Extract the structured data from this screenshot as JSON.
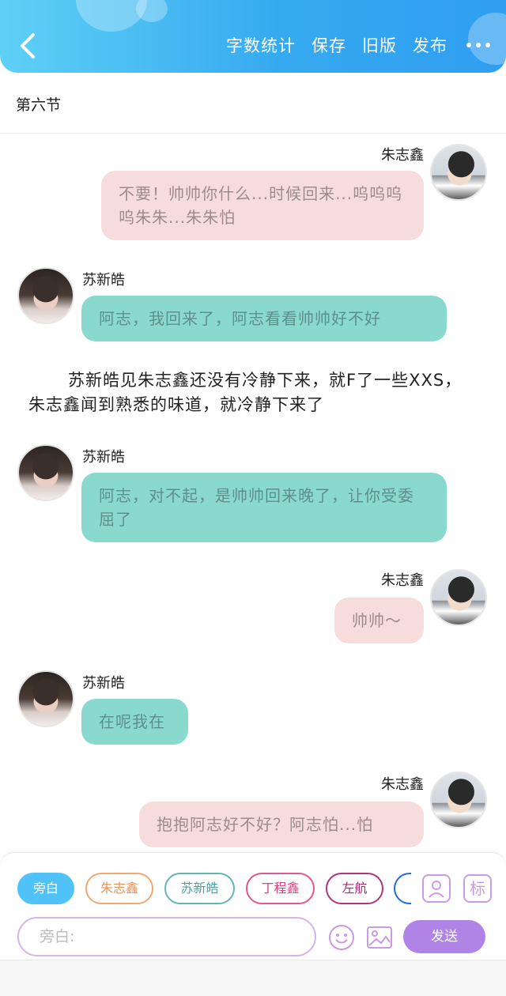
{
  "header": {
    "actions": [
      "字数统计",
      "保存",
      "旧版",
      "发布"
    ],
    "gradient_start": "#5ed0f6",
    "gradient_end": "#2f9ef0"
  },
  "section_title": "第六节",
  "messages": [
    {
      "speaker": "朱志鑫",
      "side": "right",
      "style": "pink",
      "text": "不要！帅帅你什么...时候回来...呜呜呜呜朱朱...朱朱怕"
    },
    {
      "speaker": "苏新皓",
      "side": "left",
      "style": "teal",
      "text": "阿志，我回来了，阿志看看帅帅好不好"
    },
    {
      "speaker": "苏新皓",
      "side": "left",
      "style": "teal",
      "text": "阿志，对不起，是帅帅回来晚了，让你受委屈了"
    },
    {
      "speaker": "朱志鑫",
      "side": "right",
      "style": "pink",
      "text": "帅帅～"
    },
    {
      "speaker": "苏新皓",
      "side": "left",
      "style": "teal",
      "text": "在呢我在"
    },
    {
      "speaker": "朱志鑫",
      "side": "right",
      "style": "pink",
      "text": "抱抱阿志好不好？阿志怕...怕"
    }
  ],
  "narration": "苏新皓见朱志鑫还没有冷静下来，就F了一些XXS，朱志鑫闻到熟悉的味道，就冷静下来了",
  "roles": [
    {
      "label": "旁白",
      "color": "#4fc3f7",
      "active": true
    },
    {
      "label": "朱志鑫",
      "color": "#f0a870",
      "active": false
    },
    {
      "label": "苏新皓",
      "color": "#5fb7b5",
      "active": false
    },
    {
      "label": "丁程鑫",
      "color": "#e0588f",
      "active": false
    },
    {
      "label": "左航",
      "color": "#b0357a",
      "active": false
    }
  ],
  "input": {
    "placeholder": "旁白:"
  },
  "send_label": "发送",
  "icons": [
    "back-icon",
    "more-icon",
    "character-icon",
    "mark-icon",
    "emoji-icon",
    "image-icon"
  ],
  "mark_label": "标"
}
